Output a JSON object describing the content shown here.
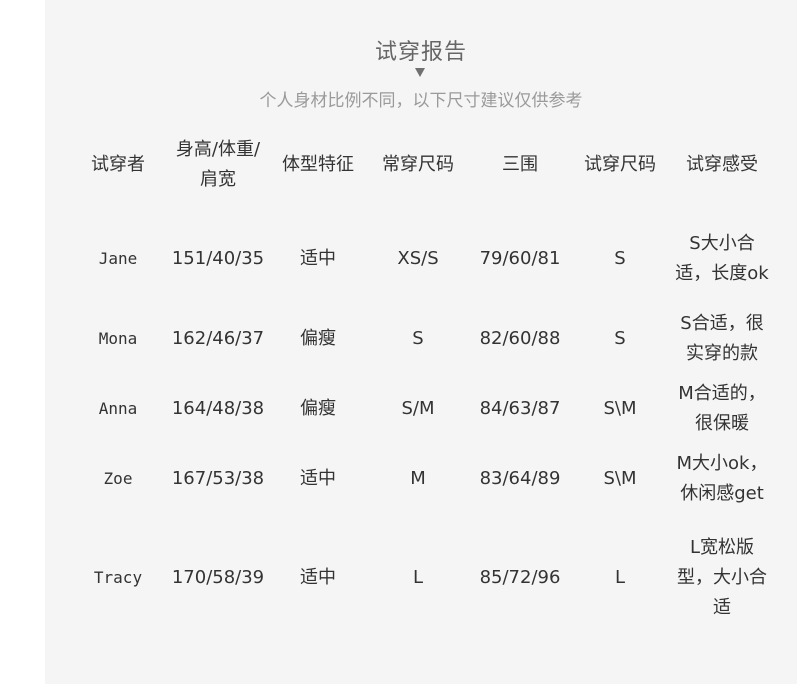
{
  "report": {
    "title": "试穿报告",
    "subtitle": "个人身材比例不同，以下尺寸建议仅供参考",
    "columns": [
      "试穿者",
      "身高/体重/肩宽",
      "体型特征",
      "常穿尺码",
      "三围",
      "试穿尺码",
      "试穿感受"
    ],
    "rows": [
      {
        "name": "Jane",
        "hwb": "151/40/35",
        "body_type": "适中",
        "usual_size": "XS/S",
        "measurements": "79/60/81",
        "tried_size": "S",
        "feedback": "S大小合适，长度ok"
      },
      {
        "name": "Mona",
        "hwb": "162/46/37",
        "body_type": "偏瘦",
        "usual_size": "S",
        "measurements": "82/60/88",
        "tried_size": "S",
        "feedback": "S合适，很实穿的款"
      },
      {
        "name": "Anna",
        "hwb": "164/48/38",
        "body_type": "偏瘦",
        "usual_size": "S/M",
        "measurements": "84/63/87",
        "tried_size": "S\\M",
        "feedback": "M合适的，很保暖"
      },
      {
        "name": "Zoe",
        "hwb": "167/53/38",
        "body_type": "适中",
        "usual_size": "M",
        "measurements": "83/64/89",
        "tried_size": "S\\M",
        "feedback": "M大小ok，休闲感get"
      },
      {
        "name": "Tracy",
        "hwb": "170/58/39",
        "body_type": "适中",
        "usual_size": "L",
        "measurements": "85/72/96",
        "tried_size": "L",
        "feedback": "L宽松版型，大小合适"
      }
    ]
  }
}
